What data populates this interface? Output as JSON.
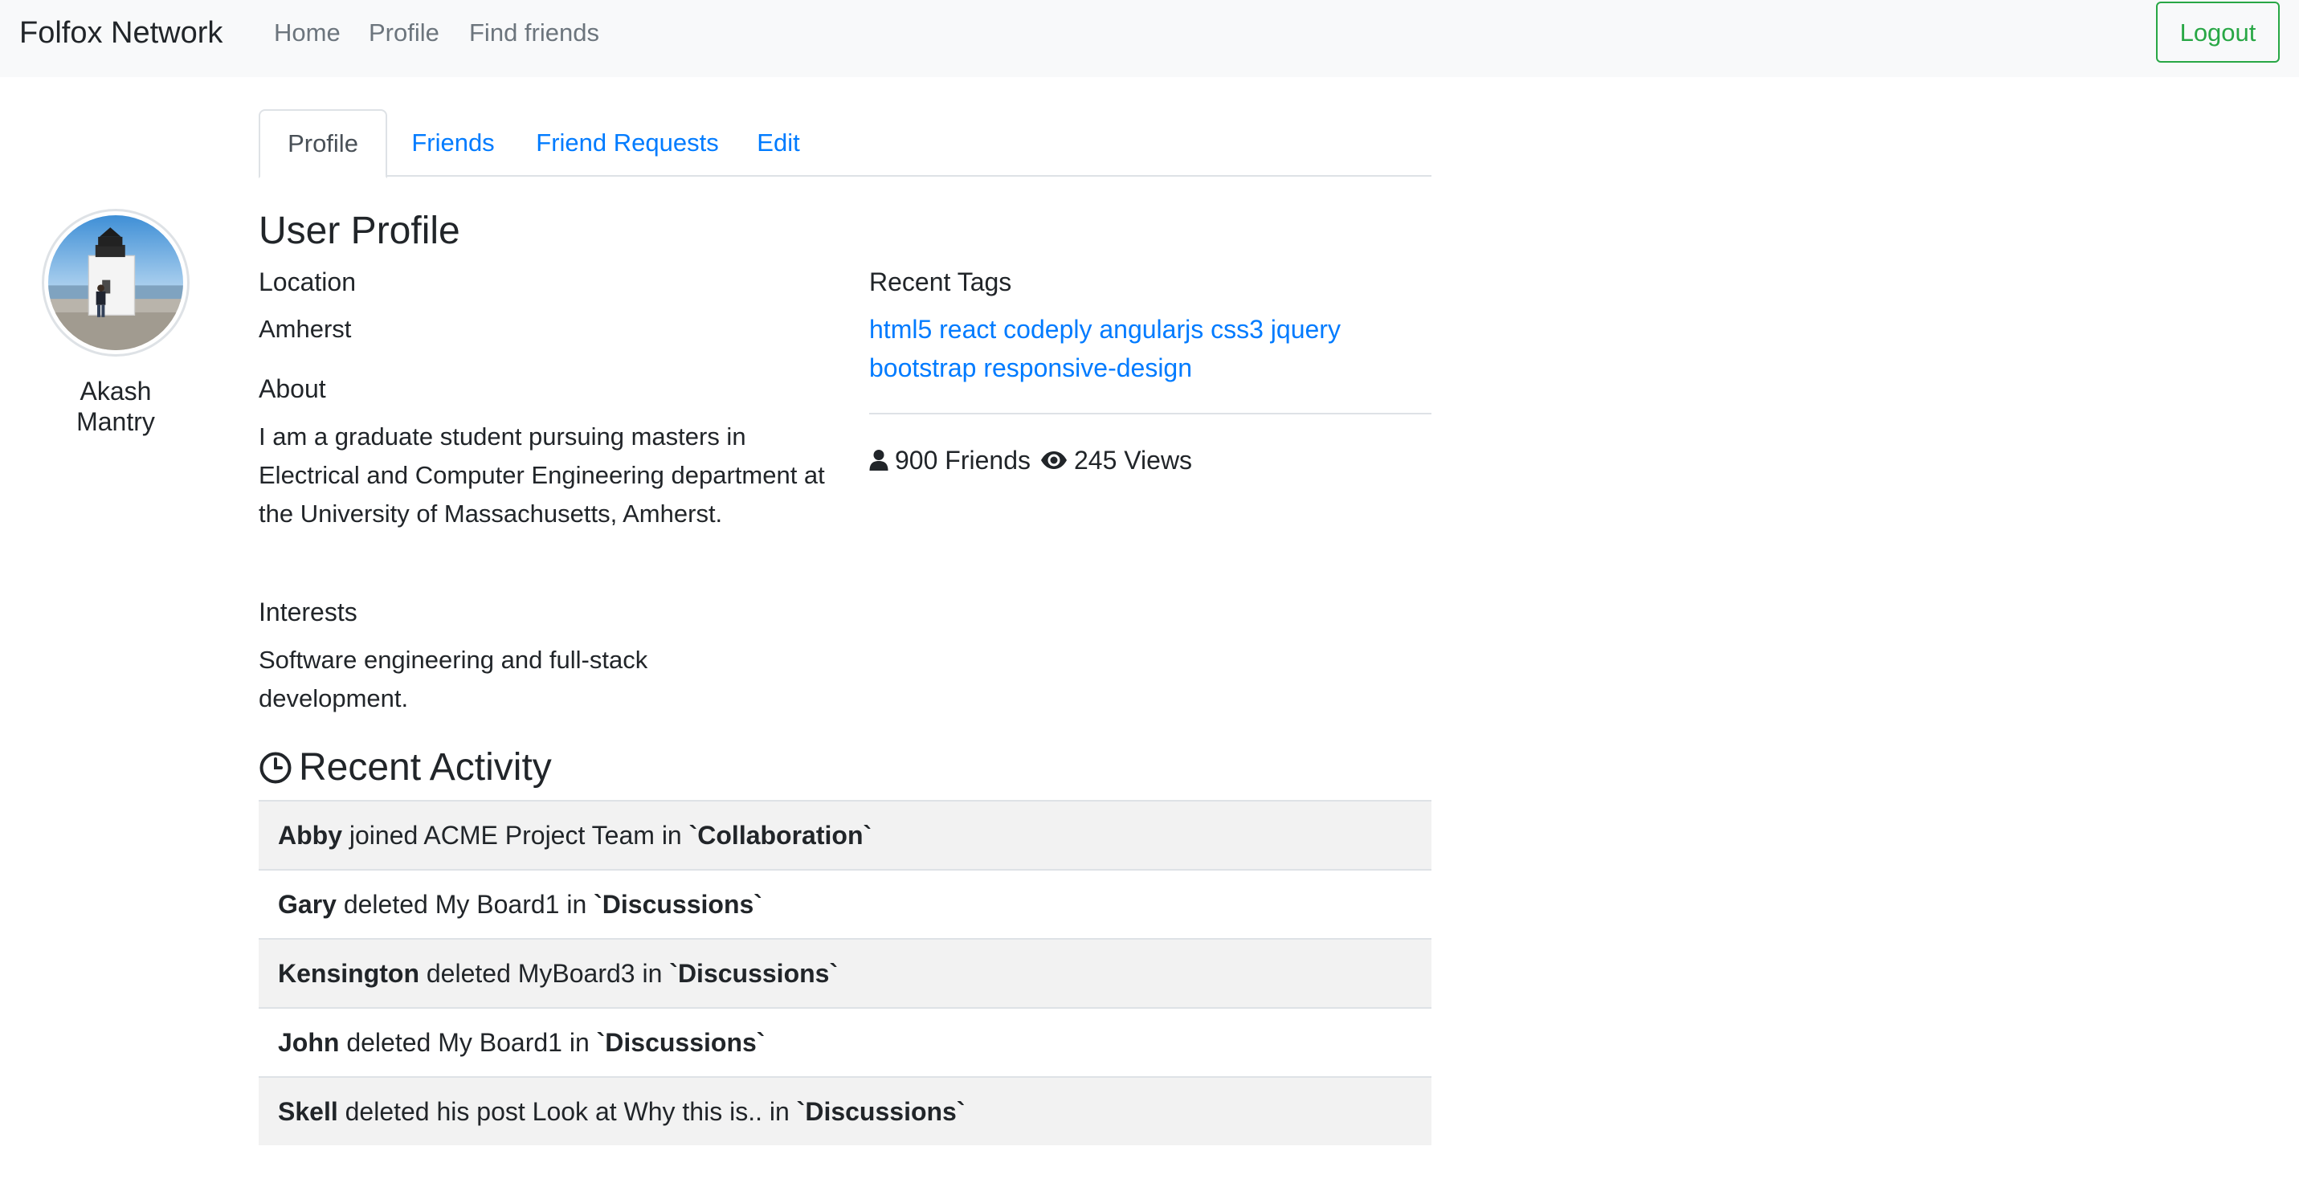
{
  "navbar": {
    "brand": "Folfox Network",
    "links": [
      "Home",
      "Profile",
      "Find friends"
    ],
    "logout_label": "Logout"
  },
  "user": {
    "name": "Akash Mantry",
    "avatar_icon": "lighthouse-photo"
  },
  "tabs": [
    {
      "label": "Profile",
      "active": true
    },
    {
      "label": "Friends",
      "active": false
    },
    {
      "label": "Friend Requests",
      "active": false
    },
    {
      "label": "Edit",
      "active": false
    }
  ],
  "profile": {
    "title": "User Profile",
    "location_label": "Location",
    "location": "Amherst",
    "about_label": "About",
    "about": "I am a graduate student pursuing masters in Electrical and Computer Engineering department at the University of Massachusetts, Amherst.",
    "interests_label": "Interests",
    "interests": "Software engineering and full-stack development.",
    "recent_tags_label": "Recent Tags",
    "tags": [
      "html5",
      "react",
      "codeply",
      "angularjs",
      "css3",
      "jquery",
      "bootstrap",
      "responsive-design"
    ],
    "friends_count": "900 Friends",
    "views_count": "245 Views"
  },
  "activity": {
    "title": "Recent Activity",
    "rows": [
      {
        "user": "Abby",
        "action": " joined ACME Project Team in ",
        "target": "`Collaboration`"
      },
      {
        "user": "Gary",
        "action": " deleted My Board1 in ",
        "target": "`Discussions`"
      },
      {
        "user": "Kensington",
        "action": " deleted MyBoard3 in ",
        "target": "`Discussions`"
      },
      {
        "user": "John",
        "action": " deleted My Board1 in ",
        "target": "`Discussions`"
      },
      {
        "user": "Skell",
        "action": " deleted his post Look at Why this is.. in ",
        "target": "`Discussions`"
      }
    ]
  },
  "colors": {
    "link": "#007bff",
    "logout": "#28a745",
    "navbar_bg": "#f8f9fa",
    "stripe": "#f2f2f2"
  }
}
